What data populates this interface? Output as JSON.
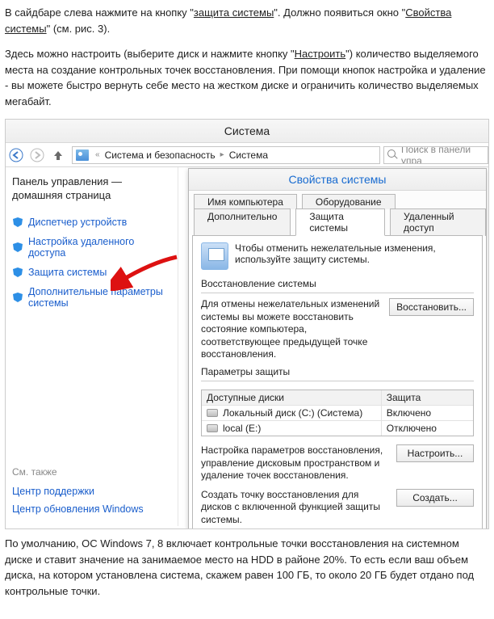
{
  "article": {
    "p1_a": "В сайдбаре слева нажмите на кнопку \"",
    "p1_link1": "защита системы",
    "p1_b": "\". Должно появиться окно \"",
    "p1_link2": "Свойства системы",
    "p1_c": "\" (см. рис. 3).",
    "p2_a": "Здесь можно настроить (выберите диск и нажмите кнопку \"",
    "p2_link": "Настроить",
    "p2_b": "\") количество выделяемого места на создание контрольных точек восстановления. При помощи кнопок настройка и удаление - вы можете быстро вернуть себе место на жестком диске и ограничить количество выделяемых мегабайт."
  },
  "window": {
    "title": "Система",
    "breadcrumbs": [
      "Система и безопасность",
      "Система"
    ],
    "search_placeholder": "Поиск в панели упра"
  },
  "sidebar": {
    "home": "Панель управления — домашняя страница",
    "links": [
      "Диспетчер устройств",
      "Настройка удаленного доступа",
      "Защита системы",
      "Дополнительные параметры системы"
    ],
    "see_also": "См. также",
    "bottom_links": [
      "Центр поддержки",
      "Центр обновления Windows"
    ]
  },
  "dialog": {
    "title": "Свойства системы",
    "tabs_row1": [
      "Имя компьютера",
      "Оборудование"
    ],
    "tabs_row2": [
      "Дополнительно",
      "Защита системы",
      "Удаленный доступ"
    ],
    "active_tab": "Защита системы",
    "intro": "Чтобы отменить нежелательные изменения, используйте защиту системы.",
    "group_restore_title": "Восстановление системы",
    "restore_text": "Для отмены нежелательных изменений системы вы можете восстановить состояние компьютера, соответствующее предыдущей точке восстановления.",
    "restore_button": "Восстановить...",
    "group_params_title": "Параметры защиты",
    "table_head": [
      "Доступные диски",
      "Защита"
    ],
    "drives": [
      {
        "name": "Локальный диск (C:) (Система)",
        "status": "Включено"
      },
      {
        "name": "local (E:)",
        "status": "Отключено"
      }
    ],
    "configure_text": "Настройка параметров восстановления, управление дисковым пространством и удаление точек восстановления.",
    "configure_button": "Настроить...",
    "create_text": "Создать точку восстановления для дисков с включенной функцией защиты системы.",
    "create_button": "Создать..."
  },
  "caption": {
    "p": "По умолчанию, ОС Windows 7, 8 включает контрольные точки восстановления на системном диске и ставит значение на занимаемое место на HDD в районе 20%. То есть если ваш объем диска, на котором установлена система, скажем равен 100 ГБ, то около 20 ГБ будет отдано под контрольные точки."
  }
}
